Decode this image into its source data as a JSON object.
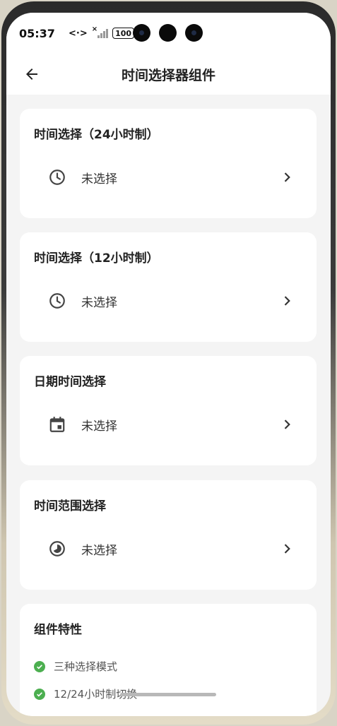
{
  "status_bar": {
    "time": "05:37",
    "nfc_glyph": "<·>",
    "signal_x": "×",
    "battery": "100"
  },
  "header": {
    "title": "时间选择器组件"
  },
  "cards": [
    {
      "title": "时间选择（24小时制）",
      "value": "未选择",
      "icon": "clock-icon"
    },
    {
      "title": "时间选择（12小时制）",
      "value": "未选择",
      "icon": "clock-icon"
    },
    {
      "title": "日期时间选择",
      "value": "未选择",
      "icon": "calendar-icon"
    },
    {
      "title": "时间范围选择",
      "value": "未选择",
      "icon": "range-icon"
    }
  ],
  "features": {
    "title": "组件特性",
    "items": [
      "三种选择模式",
      "12/24小时制切换"
    ]
  },
  "colors": {
    "accent_check": "#4caf50",
    "background": "#f4f4f4",
    "card": "#ffffff"
  }
}
